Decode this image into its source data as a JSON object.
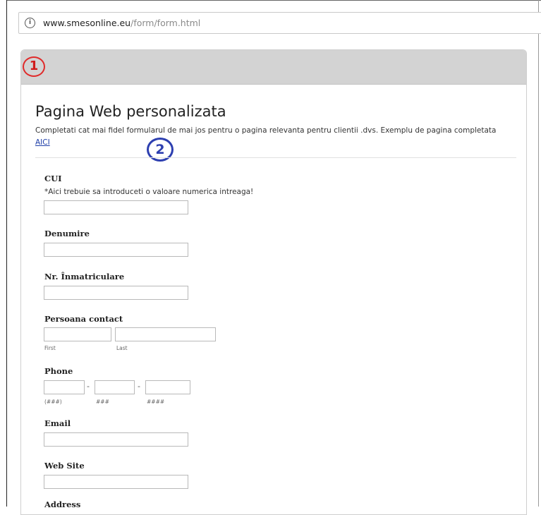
{
  "browser": {
    "url_domain": "www.smesonline.eu",
    "url_path": "/form/form.html",
    "info_icon": "i"
  },
  "annotations": {
    "one": "1",
    "two": "2",
    "one_color": "#e02a2a",
    "two_color": "#2d3fb0"
  },
  "form": {
    "title": "Pagina Web personalizata",
    "intro_text": "Completati cat mai fidel formularul de mai jos pentru o pagina relevanta pentru clientii .dvs. Exemplu de pagina completata ",
    "intro_link": "AICI",
    "fields": {
      "cui": {
        "label": "CUI",
        "note": "*Aici trebuie sa introduceti o valoare numerica intreaga!",
        "value": ""
      },
      "denumire": {
        "label": "Denumire",
        "value": ""
      },
      "nr_inmatriculare": {
        "label": "Nr. Înmatriculare",
        "value": ""
      },
      "persoana_contact": {
        "label": "Persoana contact",
        "first_caption": "First",
        "last_caption": "Last",
        "first_value": "",
        "last_value": ""
      },
      "phone": {
        "label": "Phone",
        "area_caption": "(###)",
        "prefix_caption": "###",
        "line_caption": "####",
        "separator": "-"
      },
      "email": {
        "label": "Email",
        "value": ""
      },
      "web_site": {
        "label": "Web Site",
        "value": ""
      },
      "address": {
        "label": "Address"
      }
    }
  }
}
